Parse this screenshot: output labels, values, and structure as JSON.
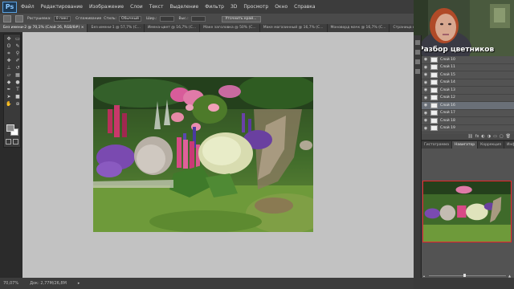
{
  "app": {
    "logo_text": "Ps"
  },
  "menubar": {
    "items": [
      "Файл",
      "Редактирование",
      "Изображение",
      "Слои",
      "Текст",
      "Выделение",
      "Фильтр",
      "3D",
      "Просмотр",
      "Окно",
      "Справка"
    ]
  },
  "options": {
    "feather_label": "Растушевка:",
    "feather_value": "0 пикс",
    "smooth_label": "Сглаживание",
    "style_label": "Стиль:",
    "style_value": "Обычный",
    "width_label": "Шир.:",
    "height_label": "Выс.:",
    "refine_button": "Уточнить край..."
  },
  "tabs": [
    {
      "label": "Без имени-2 @ 70,1% (Слой 26, RGB/8#) ×",
      "active": true
    },
    {
      "label": "Без имени-1 @ 57,7% (С...",
      "active": false
    },
    {
      "label": "Имена-цвет @ 16,7% (С...",
      "active": false
    },
    {
      "label": "Маке заголовка @ 50% (С...",
      "active": false
    },
    {
      "label": "Маке магазинный @ 16,7% (С...",
      "active": false
    },
    {
      "label": "Моноворд мачк @ 16,7% (С...",
      "active": false
    },
    {
      "label": "Страница колофон доп. серия блок Semicentro Blow @...",
      "active": false
    }
  ],
  "tab_overflow": "»",
  "statusbar": {
    "zoom": "70,07%",
    "doc": "Док: 2,77М/26,8М",
    "arrow": "▸"
  },
  "video": {
    "caption": "Разбор цветников"
  },
  "layers": [
    {
      "name": "Слой 10",
      "selected": false
    },
    {
      "name": "Слой 11",
      "selected": false
    },
    {
      "name": "Слой 15",
      "selected": false
    },
    {
      "name": "Слой 14",
      "selected": false
    },
    {
      "name": "Слой 13",
      "selected": false
    },
    {
      "name": "Слой 12",
      "selected": false
    },
    {
      "name": "Слой 16",
      "selected": true
    },
    {
      "name": "Слой 17",
      "selected": false
    },
    {
      "name": "Слой 18",
      "selected": false
    },
    {
      "name": "Слой 19",
      "selected": false
    }
  ],
  "layers_footer": [
    "⛓",
    "fx",
    "◐",
    "◑",
    "▭",
    "▢",
    "🗑"
  ],
  "nav_tabs": [
    {
      "label": "Гистограмма",
      "active": false
    },
    {
      "label": "Навигатор",
      "active": true
    },
    {
      "label": "Коррекция",
      "active": false
    },
    {
      "label": "Инфо",
      "active": false
    }
  ],
  "navigator": {
    "zoom_level": 0.45
  },
  "colors": {
    "accent": "#e8232b",
    "workspace": "#c2c2c2"
  }
}
